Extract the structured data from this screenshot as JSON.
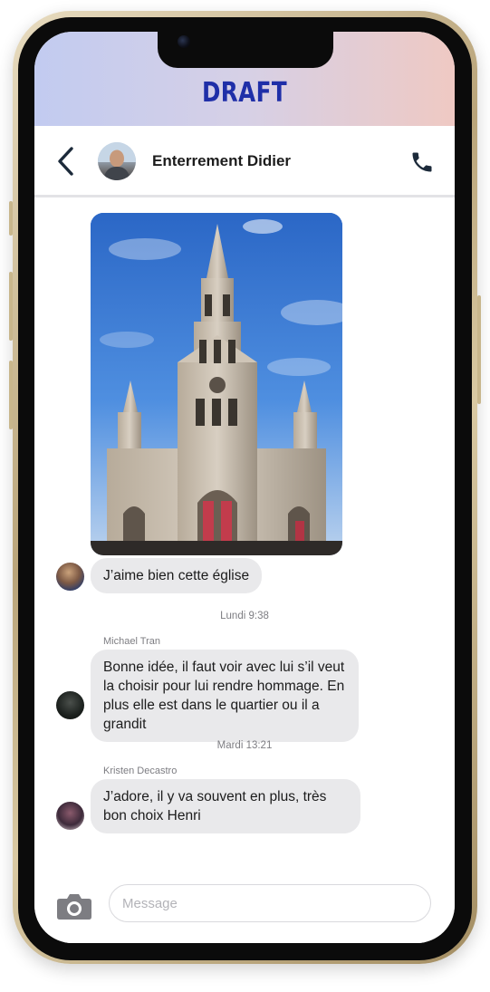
{
  "banner": {
    "label": "DRAFT"
  },
  "header": {
    "contact_name": "Enterrement Didier"
  },
  "messages": [
    {
      "text": "J’aime bien cette église"
    },
    {
      "timestamp": "Lundi 9:38",
      "sender": "Michael Tran",
      "text": "Bonne idée, il faut voir avec lui s’il veut la choisir pour lui rendre hommage. En plus elle est dans le quartier ou il a grandit"
    },
    {
      "timestamp": "Mardi 13:21",
      "sender": "Kristen Decastro",
      "text": "J’adore, il y va souvent en plus, très bon choix Henri"
    }
  ],
  "composer": {
    "placeholder": "Message"
  },
  "icons": {
    "back": "chevron-left-icon",
    "call": "phone-icon",
    "camera": "camera-icon"
  },
  "colors": {
    "banner_text": "#1f2fa8",
    "bubble": "#e9e9eb",
    "header_icons": "#1c2a3a"
  }
}
